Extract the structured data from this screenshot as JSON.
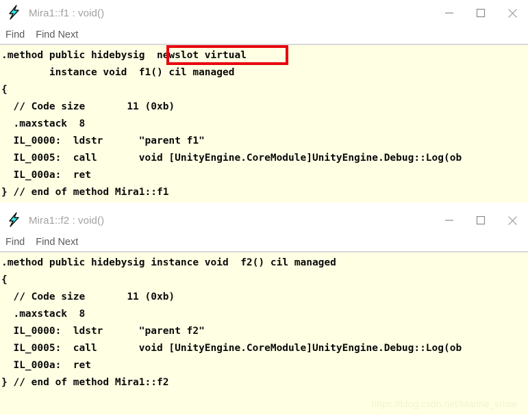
{
  "windows": [
    {
      "title": "Mira1::f1 : void()",
      "icon": "lightning-bolt-icon",
      "menu": {
        "find": "Find",
        "find_next": "Find Next"
      },
      "controls": {
        "minimize": "minimize-icon",
        "maximize": "maximize-icon",
        "close": "close-icon"
      },
      "code_lines": [
        ".method public hidebysig  newslot virtual",
        "        instance void  f1() cil managed",
        "{",
        "  // Code size       11 (0xb)",
        "  .maxstack  8",
        "  IL_0000:  ldstr      \"parent f1\"",
        "  IL_0005:  call       void [UnityEngine.CoreModule]UnityEngine.Debug::Log(ob",
        "  IL_000a:  ret",
        "} // end of method Mira1::f1"
      ],
      "annotation": {
        "label": "newslot virtual",
        "color": "#e8000d"
      }
    },
    {
      "title": "Mira1::f2 : void()",
      "icon": "lightning-bolt-icon",
      "menu": {
        "find": "Find",
        "find_next": "Find Next"
      },
      "controls": {
        "minimize": "minimize-icon",
        "maximize": "maximize-icon",
        "close": "close-icon"
      },
      "code_lines": [
        ".method public hidebysig instance void  f2() cil managed",
        "{",
        "  // Code size       11 (0xb)",
        "  .maxstack  8",
        "  IL_0000:  ldstr      \"parent f2\"",
        "  IL_0005:  call       void [UnityEngine.CoreModule]UnityEngine.Debug::Log(ob",
        "  IL_000a:  ret",
        "} // end of method Mira1::f2"
      ]
    }
  ],
  "watermark": "https://blog.csdn.net/Marine_snow",
  "colors": {
    "code_background": "#ffffe4",
    "code_text": "#0a0a0a",
    "title_text": "#a0a0a0",
    "menu_text": "#5a5a5a",
    "annotation": "#e8000d",
    "icon_cyan": "#2fe9e9"
  }
}
